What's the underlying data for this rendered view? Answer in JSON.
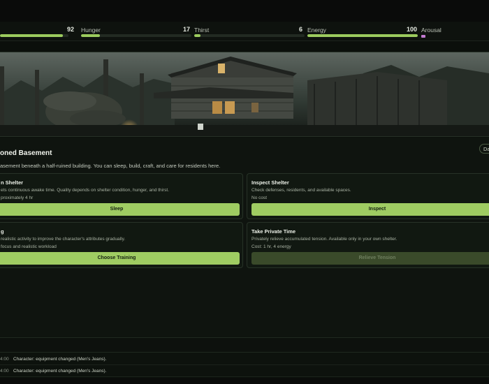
{
  "stats": {
    "health": {
      "value": "92",
      "fraction": 0.92
    },
    "hunger": {
      "label": "Hunger",
      "value": "17",
      "fraction": 0.17
    },
    "thirst": {
      "label": "Thirst",
      "value": "6",
      "fraction": 0.06
    },
    "energy": {
      "label": "Energy",
      "value": "100",
      "fraction": 1.0
    },
    "arousal": {
      "label": "Arousal",
      "color": "#c27ad0"
    }
  },
  "location": {
    "title": "oned Basement",
    "badge": "Da",
    "description": "asement beneath a half-ruined building. You can sleep, build, craft, and care for residents here."
  },
  "actions": [
    {
      "title": "n Shelter",
      "desc": "ets continuous awake time. Quality depends on shelter condition, hunger, and thirst.",
      "cost": "proximately 4 hr",
      "button": "Sleep",
      "enabled": true
    },
    {
      "title": "Inspect Shelter",
      "desc": "Check defenses, residents, and available spaces.",
      "cost": "No cost",
      "button": "Inspect",
      "enabled": true
    },
    {
      "title": "g",
      "desc": "realistic activity to improve the character's attributes gradually.",
      "cost": "focus and realistic workload",
      "button": "Choose Training",
      "enabled": true
    },
    {
      "title": "Take Private Time",
      "desc": "Privately relieve accumulated tension. Available only in your own shelter.",
      "cost": "Cost: 1 hr, 4 energy",
      "button": "Relieve Tension",
      "enabled": false
    }
  ],
  "log": [
    {
      "time": "4:00",
      "text": "Character: equipment changed (Men's Jeans)."
    },
    {
      "time": "4:00",
      "text": "Character: equipment changed (Men's Jeans)."
    }
  ],
  "colors": {
    "accent": "#9fcc62",
    "background": "#0f140f"
  }
}
